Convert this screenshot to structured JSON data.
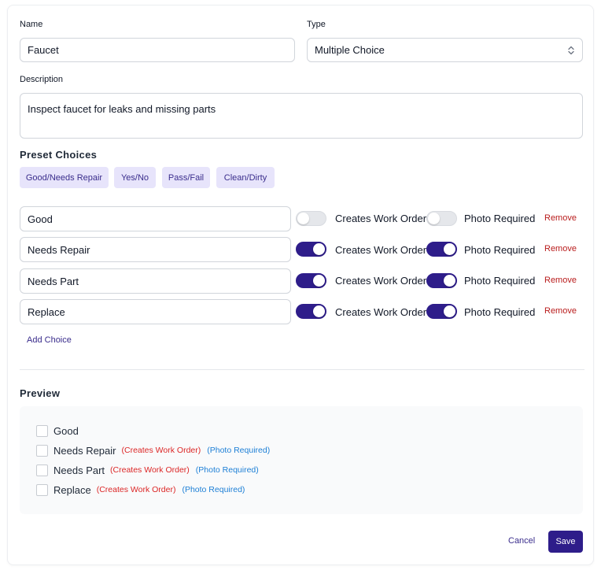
{
  "form": {
    "name_label": "Name",
    "name_value": "Faucet",
    "type_label": "Type",
    "type_value": "Multiple Choice",
    "description_label": "Description",
    "description_value": "Inspect faucet for leaks and missing parts"
  },
  "preset": {
    "title": "Preset Choices",
    "chips": [
      "Good/Needs Repair",
      "Yes/No",
      "Pass/Fail",
      "Clean/Dirty"
    ]
  },
  "choices": {
    "creates_work_order_label": "Creates Work Order",
    "photo_required_label": "Photo Required",
    "remove_label": "Remove",
    "add_label": "Add Choice",
    "items": [
      {
        "value": "Good",
        "creates_work_order": false,
        "photo_required": false
      },
      {
        "value": "Needs Repair",
        "creates_work_order": true,
        "photo_required": true
      },
      {
        "value": "Needs Part",
        "creates_work_order": true,
        "photo_required": true
      },
      {
        "value": "Replace",
        "creates_work_order": true,
        "photo_required": true
      }
    ]
  },
  "preview": {
    "title": "Preview",
    "work_order_tag": "(Creates Work Order)",
    "photo_tag": "(Photo Required)",
    "items": [
      "Good",
      "Needs Repair",
      "Needs Part",
      "Replace"
    ]
  },
  "actions": {
    "cancel_label": "Cancel",
    "save_label": "Save"
  },
  "colors": {
    "accent": "#2e1d8a",
    "chip_bg": "#e7e4fb",
    "remove": "#b91c1c",
    "work_order_tag": "#dc2626",
    "photo_tag": "#1d7fd6"
  }
}
